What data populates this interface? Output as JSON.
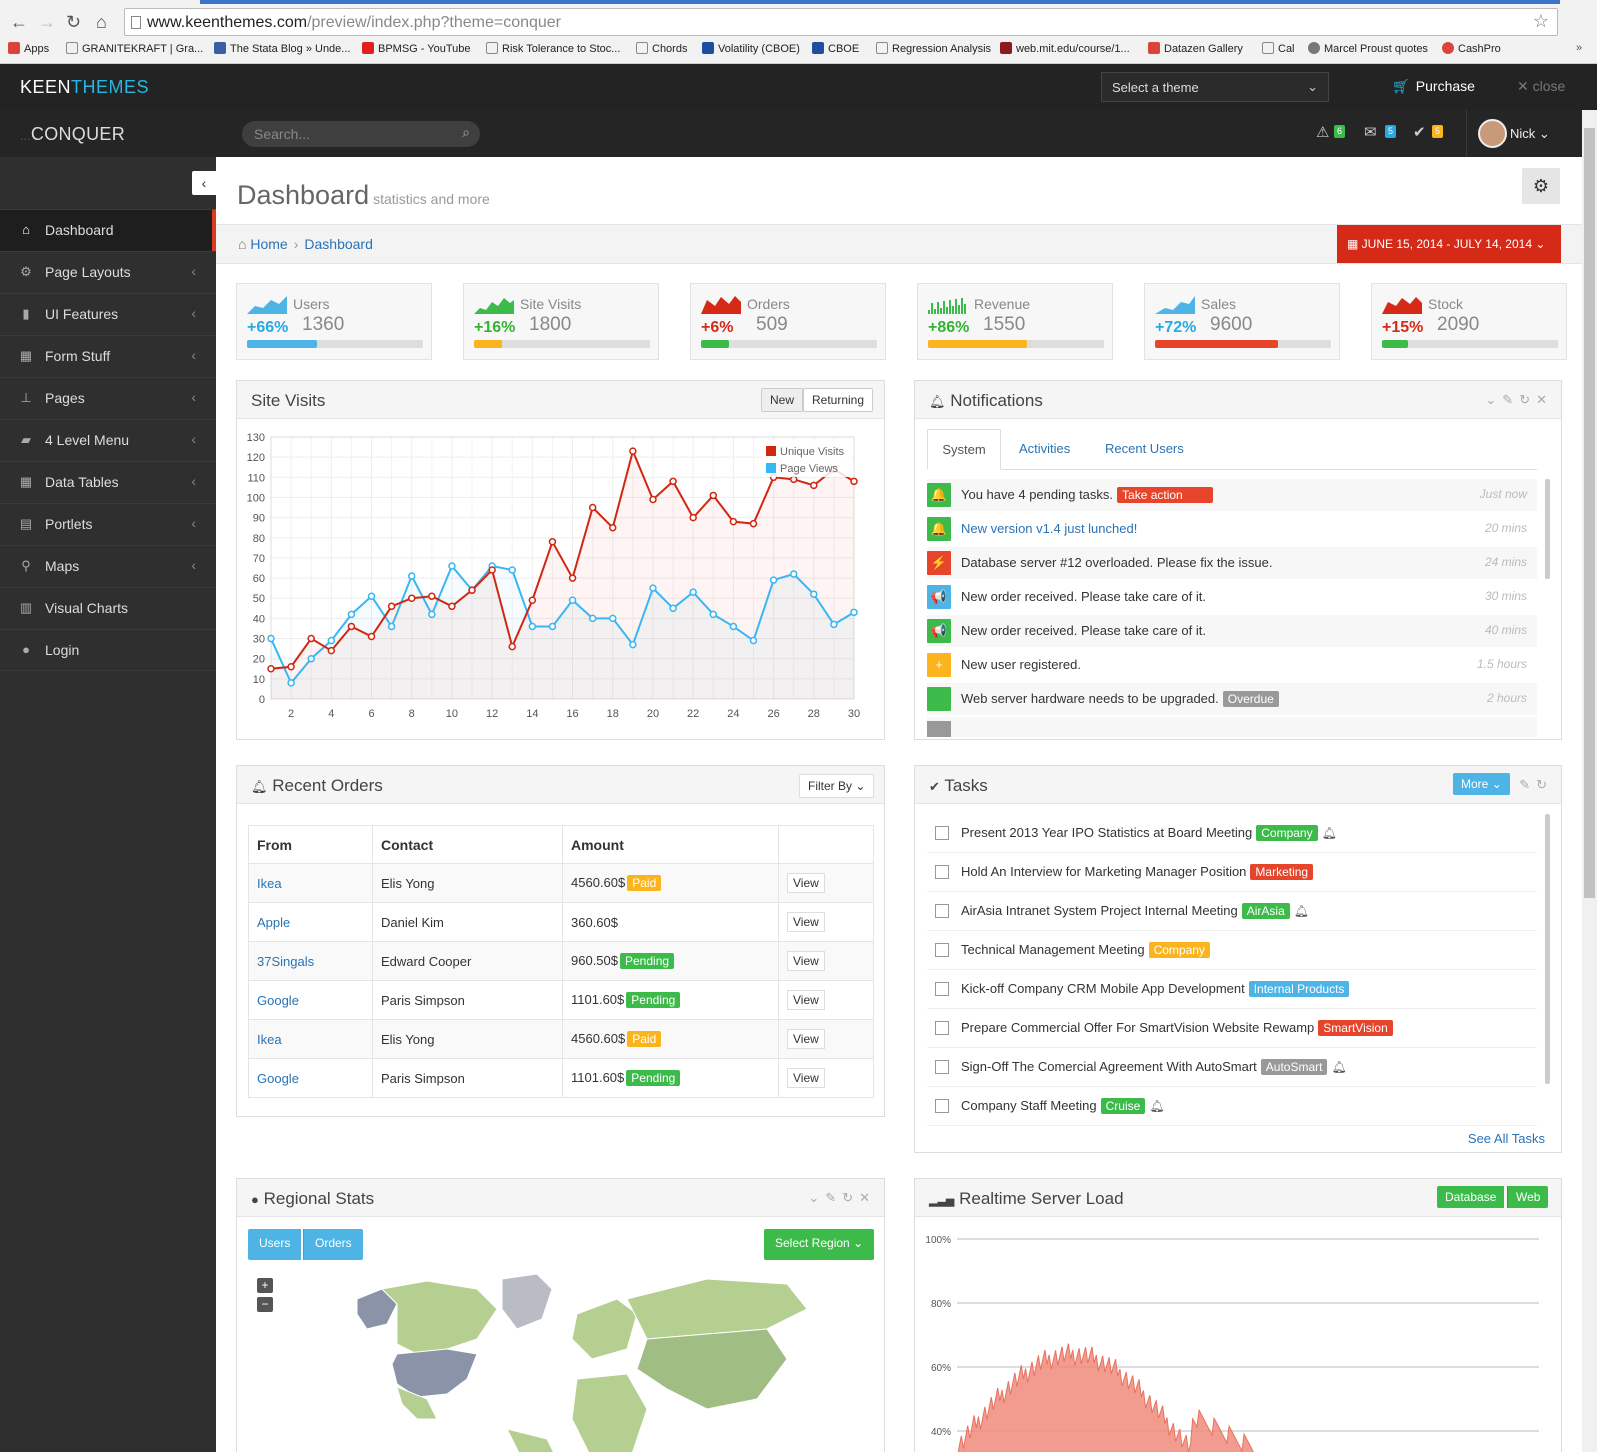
{
  "browser": {
    "url_host": "www.keenthemes.com",
    "url_path": "/preview/index.php?theme=conquer",
    "bookmarks": [
      "Apps",
      "GRANITEKRAFT | Gra...",
      "The Stata Blog » Unde...",
      "BPMSG - YouTube",
      "Risk Tolerance to Stoc...",
      "Chords",
      "Volatility (CBOE)",
      "CBOE",
      "Regression Analysis",
      "web.mit.edu/course/1...",
      "Datazen Gallery",
      "Cal",
      "Marcel Proust quotes",
      "CashPro"
    ]
  },
  "keenbar": {
    "logo_a": "KEEN",
    "logo_b": "THEMES",
    "theme_select": "Select a theme",
    "purchase": "Purchase",
    "close": "close"
  },
  "header": {
    "brand": "CONQUER",
    "search_placeholder": "Search...",
    "badges": {
      "alerts": "6",
      "mail": "5",
      "tasks": "5"
    },
    "user": "Nick"
  },
  "sidebar": {
    "items": [
      {
        "label": "Dashboard",
        "icon": "home-icon"
      },
      {
        "label": "Page Layouts",
        "icon": "cogs-icon"
      },
      {
        "label": "UI Features",
        "icon": "bookmark-icon"
      },
      {
        "label": "Form Stuff",
        "icon": "table-icon"
      },
      {
        "label": "Pages",
        "icon": "sitemap-icon"
      },
      {
        "label": "4 Level Menu",
        "icon": "folder-open-icon"
      },
      {
        "label": "Data Tables",
        "icon": "grid-icon"
      },
      {
        "label": "Portlets",
        "icon": "file-icon"
      },
      {
        "label": "Maps",
        "icon": "map-marker-icon"
      },
      {
        "label": "Visual Charts",
        "icon": "bar-chart-icon"
      },
      {
        "label": "Login",
        "icon": "user-icon"
      }
    ]
  },
  "page": {
    "title": "Dashboard",
    "subtitle": "statistics and more",
    "breadcrumb": [
      "Home",
      "Dashboard"
    ],
    "date_range": "JUNE 15, 2014 - JULY 14, 2014"
  },
  "stats": [
    {
      "name": "Users",
      "pct": "+66%",
      "value": "1360",
      "progress": 0.4,
      "color": "#4eb3e5",
      "pctcolor": "#27a9e3"
    },
    {
      "name": "Site Visits",
      "pct": "+16%",
      "value": "1800",
      "progress": 0.16,
      "color": "#fbb41e",
      "pctcolor": "#32b332"
    },
    {
      "name": "Orders",
      "pct": "+6%",
      "value": "509",
      "progress": 0.16,
      "color": "#3dbb4a",
      "pctcolor": "#d62a18"
    },
    {
      "name": "Revenue",
      "pct": "+86%",
      "value": "1550",
      "progress": 0.56,
      "color": "#fbb41e",
      "pctcolor": "#32b332"
    },
    {
      "name": "Sales",
      "pct": "+72%",
      "value": "9600",
      "progress": 0.7,
      "color": "#e6452b",
      "pctcolor": "#27a9e3"
    },
    {
      "name": "Stock",
      "pct": "+15%",
      "value": "2090",
      "progress": 0.15,
      "color": "#3dbb4a",
      "pctcolor": "#d62a18"
    }
  ],
  "site_visits": {
    "title": "Site Visits",
    "toggle": [
      "New",
      "Returning"
    ]
  },
  "chart_data": {
    "type": "line",
    "x": [
      1,
      2,
      3,
      4,
      5,
      6,
      7,
      8,
      9,
      10,
      11,
      12,
      13,
      14,
      15,
      16,
      17,
      18,
      19,
      20,
      21,
      22,
      23,
      24,
      25,
      26,
      27,
      28,
      29,
      30
    ],
    "ylim": [
      0,
      130
    ],
    "xticks": [
      2,
      4,
      6,
      8,
      10,
      12,
      14,
      16,
      18,
      20,
      22,
      24,
      26,
      28,
      30
    ],
    "yticks": [
      0,
      10,
      20,
      30,
      40,
      50,
      60,
      70,
      80,
      90,
      100,
      110,
      120,
      130
    ],
    "series": [
      {
        "name": "Unique Visits",
        "color": "#d12610",
        "values": [
          15,
          16,
          30,
          24,
          36,
          31,
          46,
          50,
          51,
          46,
          54,
          64,
          26,
          49,
          78,
          60,
          95,
          85,
          123,
          99,
          108,
          90,
          101,
          88,
          87,
          110,
          109,
          106,
          114,
          108
        ]
      },
      {
        "name": "Page Views",
        "color": "#37b7f3",
        "values": [
          30,
          8,
          20,
          29,
          42,
          51,
          36,
          61,
          42,
          66,
          54,
          66,
          64,
          36,
          36,
          49,
          40,
          40,
          27,
          55,
          45,
          53,
          42,
          36,
          29,
          59,
          62,
          52,
          37,
          43
        ]
      }
    ],
    "grid": true,
    "legend": "top-right"
  },
  "notifications": {
    "title": "Notifications",
    "tabs": [
      "System",
      "Activities",
      "Recent Users"
    ],
    "rows": [
      {
        "text": "You have 4 pending tasks.",
        "label": "Take action",
        "label_color": "#e6452b",
        "time": "Just now",
        "icon": "bell-icon",
        "color": "#3dbb4a",
        "glyph": "🔔",
        "link": false
      },
      {
        "text": "New version v1.4 just lunched!",
        "label": "",
        "label_color": "",
        "time": "20 mins",
        "icon": "bell-icon",
        "color": "#3dbb4a",
        "glyph": "🔔",
        "link": true
      },
      {
        "text": "Database server #12 overloaded. Please fix the issue.",
        "label": "",
        "label_color": "",
        "time": "24 mins",
        "icon": "bolt-icon",
        "color": "#e6452b",
        "glyph": "⚡",
        "link": false
      },
      {
        "text": "New order received. Please take care of it.",
        "label": "",
        "label_color": "",
        "time": "30 mins",
        "icon": "bullhorn-icon",
        "color": "#4eb3e5",
        "glyph": "📢",
        "link": false
      },
      {
        "text": "New order received. Please take care of it.",
        "label": "",
        "label_color": "",
        "time": "40 mins",
        "icon": "bullhorn-icon",
        "color": "#3dbb4a",
        "glyph": "📢",
        "link": false
      },
      {
        "text": "New user registered.",
        "label": "",
        "label_color": "",
        "time": "1.5 hours",
        "icon": "plus-icon",
        "color": "#fbb41e",
        "glyph": "+",
        "link": false
      },
      {
        "text": "Web server hardware needs to be upgraded.",
        "label": "Overdue",
        "label_color": "#999",
        "time": "2 hours",
        "icon": "server-icon",
        "color": "#3dbb4a",
        "glyph": "",
        "link": false
      }
    ]
  },
  "orders": {
    "title": "Recent Orders",
    "filter": "Filter By",
    "columns": [
      "From",
      "Contact",
      "Amount",
      ""
    ],
    "view": "View",
    "rows": [
      {
        "from": "Ikea",
        "contact": "Elis Yong",
        "amount": "4560.60$",
        "status": "Paid",
        "status_color": "#fbb41e"
      },
      {
        "from": "Apple",
        "contact": "Daniel Kim",
        "amount": "360.60$",
        "status": "",
        "status_color": ""
      },
      {
        "from": "37Singals",
        "contact": "Edward Cooper",
        "amount": "960.50$",
        "status": "Pending",
        "status_color": "#3dbb4a"
      },
      {
        "from": "Google",
        "contact": "Paris Simpson",
        "amount": "1101.60$",
        "status": "Pending",
        "status_color": "#3dbb4a"
      },
      {
        "from": "Ikea",
        "contact": "Elis Yong",
        "amount": "4560.60$",
        "status": "Paid",
        "status_color": "#fbb41e"
      },
      {
        "from": "Google",
        "contact": "Paris Simpson",
        "amount": "1101.60$",
        "status": "Pending",
        "status_color": "#3dbb4a"
      }
    ]
  },
  "tasks": {
    "title": "Tasks",
    "more": "More",
    "see_all": "See All Tasks",
    "rows": [
      {
        "text": "Present 2013 Year IPO Statistics at Board Meeting",
        "label": "Company",
        "color": "#3dbb4a",
        "bell": true
      },
      {
        "text": "Hold An Interview for Marketing Manager Position",
        "label": "Marketing",
        "color": "#e6452b",
        "bell": false
      },
      {
        "text": "AirAsia Intranet System Project Internal Meeting",
        "label": "AirAsia",
        "color": "#3dbb4a",
        "bell": true
      },
      {
        "text": "Technical Management Meeting",
        "label": "Company",
        "color": "#fbb41e",
        "bell": false
      },
      {
        "text": "Kick-off Company CRM Mobile App Development",
        "label": "Internal Products",
        "color": "#4eb3e5",
        "bell": false
      },
      {
        "text": "Prepare Commercial Offer For SmartVision Website Rewamp",
        "label": "SmartVision",
        "color": "#e6452b",
        "bell": false
      },
      {
        "text": "Sign-Off The Comercial Agreement With AutoSmart",
        "label": "AutoSmart",
        "color": "#999999",
        "bell": true
      },
      {
        "text": "Company Staff Meeting",
        "label": "Cruise",
        "color": "#3dbb4a",
        "bell": true
      }
    ]
  },
  "regional": {
    "title": "Regional Stats",
    "tabs": [
      "Users",
      "Orders"
    ],
    "select": "Select Region"
  },
  "server_load": {
    "title": "Realtime Server Load",
    "tabs": [
      "Database",
      "Web"
    ],
    "yticks": [
      "100%",
      "80%",
      "60%",
      "40%"
    ]
  }
}
